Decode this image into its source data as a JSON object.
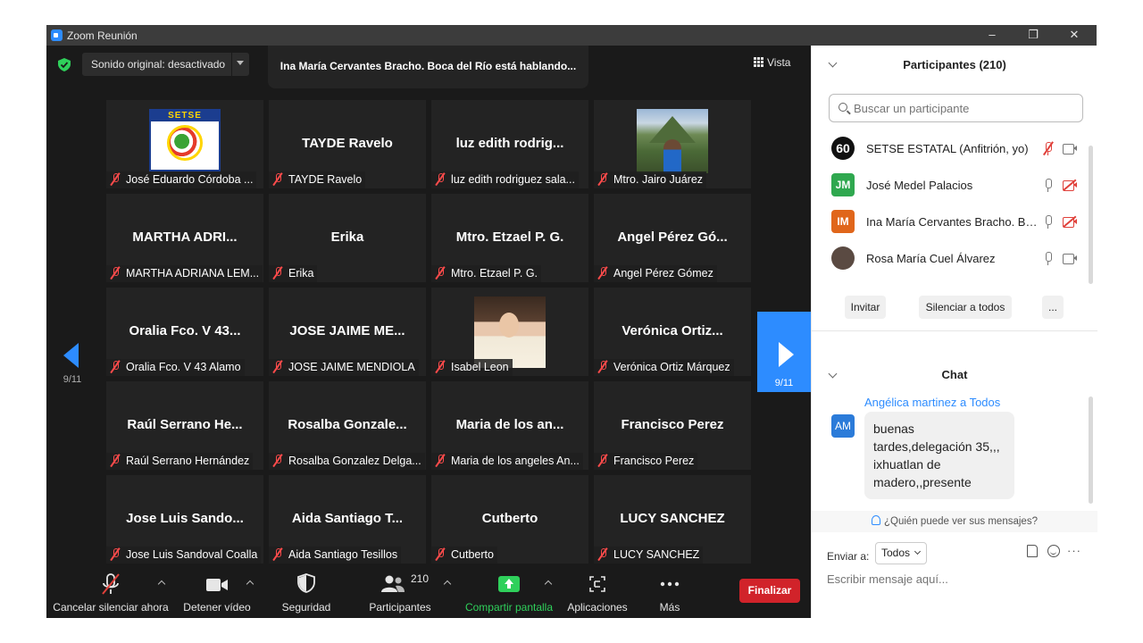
{
  "window": {
    "title": "Zoom Reunión",
    "controls": [
      "–",
      "❐",
      "✕"
    ]
  },
  "top_bar": {
    "audio_setting": "Sonido original: desactivado",
    "speaking": "Ina María Cervantes Bracho. Boca del Río está hablando...",
    "view_label": "Vista"
  },
  "pagination": {
    "prev": "9/11",
    "next": "9/11"
  },
  "tiles": [
    {
      "big": "",
      "name": "José Eduardo Córdoba ...",
      "photo": "setse",
      "logo_text": "SETSE"
    },
    {
      "big": "TAYDE Ravelo",
      "name": "TAYDE Ravelo"
    },
    {
      "big": "luz edith rodrig...",
      "name": "luz edith rodriguez sala..."
    },
    {
      "big": "",
      "name": "Mtro. Jairo Juárez",
      "photo": "mountain"
    },
    {
      "big": "MARTHA ADRI...",
      "name": "MARTHA ADRIANA LEM..."
    },
    {
      "big": "Erika",
      "name": "Erika"
    },
    {
      "big": "Mtro. Etzael P. G.",
      "name": "Mtro. Etzael P. G."
    },
    {
      "big": "Angel Pérez Gó...",
      "name": "Angel Pérez Gómez"
    },
    {
      "big": "Oralia Fco. V 43...",
      "name": "Oralia Fco. V 43 Alamo"
    },
    {
      "big": "JOSE JAIME ME...",
      "name": "JOSE JAIME MENDIOLA"
    },
    {
      "big": "",
      "name": "Isabel Leon",
      "photo": "portrait"
    },
    {
      "big": "Verónica Ortiz...",
      "name": "Verónica Ortiz Márquez"
    },
    {
      "big": "Raúl Serrano He...",
      "name": "Raúl Serrano Hernández"
    },
    {
      "big": "Rosalba Gonzale...",
      "name": "Rosalba Gonzalez Delga..."
    },
    {
      "big": "Maria de los an...",
      "name": "Maria de los angeles An..."
    },
    {
      "big": "Francisco Perez",
      "name": "Francisco Perez"
    },
    {
      "big": "Jose Luis Sando...",
      "name": "Jose Luis Sandoval Coalla"
    },
    {
      "big": "Aida Santiago T...",
      "name": "Aida Santiago Tesillos"
    },
    {
      "big": "Cutberto",
      "name": "Cutberto"
    },
    {
      "big": "LUCY SANCHEZ",
      "name": "LUCY SANCHEZ"
    }
  ],
  "toolbar": {
    "unmute": "Cancelar silenciar ahora",
    "stop_video": "Detener vídeo",
    "security": "Seguridad",
    "participants": "Participantes",
    "participants_count": "210",
    "share": "Compartir pantalla",
    "apps": "Aplicaciones",
    "more": "Más",
    "end": "Finalizar",
    "share_color": "#2fd05b"
  },
  "participants_panel": {
    "title": "Participantes (210)",
    "search_placeholder": "Buscar un participante",
    "list": [
      {
        "initials": "60",
        "color": "#111111",
        "name": "SETSE ESTATAL (Anfitrión, yo)",
        "mic_muted": true,
        "cam_off": false
      },
      {
        "initials": "JM",
        "color": "#2fa84f",
        "name": "José Medel Palacios",
        "mic_muted": false,
        "cam_off": true
      },
      {
        "initials": "IM",
        "color": "#e0661b",
        "name": "Ina María Cervantes Bracho. Bo...",
        "mic_muted": false,
        "cam_off": true
      },
      {
        "initials": "",
        "color": "#5a4a42",
        "name": "Rosa María Cuel Álvarez",
        "mic_muted": false,
        "cam_off": false
      }
    ],
    "buttons": {
      "invite": "Invitar",
      "mute_all": "Silenciar a todos",
      "more": "..."
    }
  },
  "chat": {
    "title": "Chat",
    "message": {
      "sender": "Angélica martinez",
      "to_word": "a",
      "recipient": "Todos",
      "avatar": "AM",
      "text": "buenas tardes,delegación 35,,, ixhuatlan de madero,,presente"
    },
    "who_can_see": "¿Quién puede ver sus mensajes?",
    "send_to_label": "Enviar a:",
    "send_to_value": "Todos",
    "input_placeholder": "Escribir mensaje aquí..."
  }
}
